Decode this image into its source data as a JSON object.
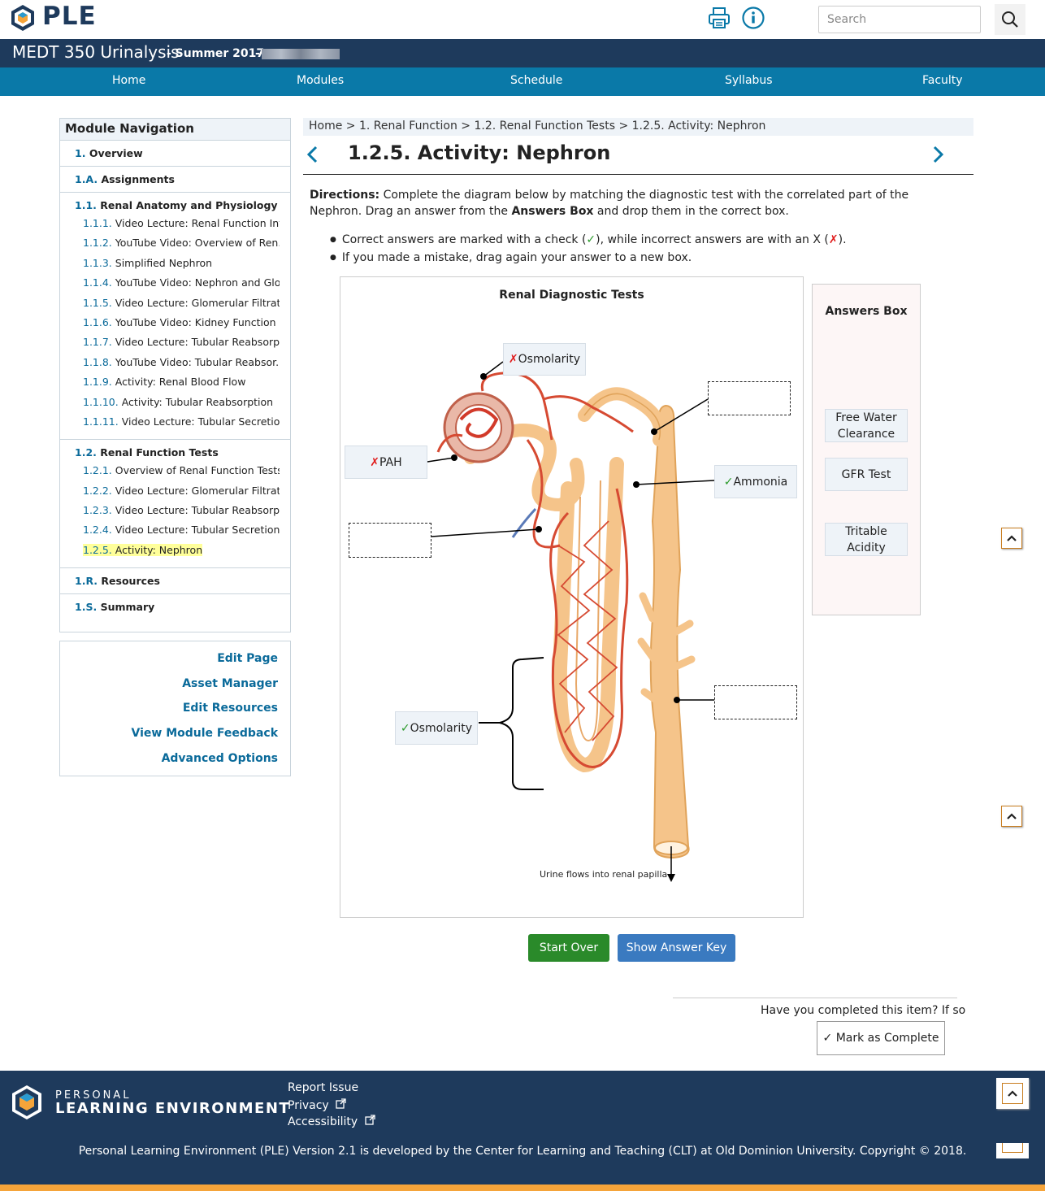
{
  "header": {
    "logo_text": "PLE",
    "search_placeholder": "Search",
    "course_title": "MEDT 350 Urinalysis",
    "course_term": "- Summer 2017",
    "course_sep": "-"
  },
  "nav": [
    "Home",
    "Modules",
    "Schedule",
    "Syllabus",
    "Faculty"
  ],
  "sidebar": {
    "title": "Module Navigation",
    "top_items": [
      {
        "num": "1.",
        "label": "Overview"
      },
      {
        "num": "1.A.",
        "label": "Assignments"
      }
    ],
    "group1": {
      "num": "1.1.",
      "label": "Renal Anatomy and Physiology",
      "items": [
        {
          "num": "1.1.1.",
          "label": "Video Lecture: Renal Function Int..."
        },
        {
          "num": "1.1.2.",
          "label": "YouTube Video: Overview of Ren..."
        },
        {
          "num": "1.1.3.",
          "label": "Simplified Nephron"
        },
        {
          "num": "1.1.4.",
          "label": "YouTube Video: Nephron and Glo..."
        },
        {
          "num": "1.1.5.",
          "label": "Video Lecture: Glomerular Filtrati..."
        },
        {
          "num": "1.1.6.",
          "label": "YouTube Video: Kidney Function"
        },
        {
          "num": "1.1.7.",
          "label": "Video Lecture: Tubular Reabsorpt..."
        },
        {
          "num": "1.1.8.",
          "label": "YouTube Video: Tubular Reabsor..."
        },
        {
          "num": "1.1.9.",
          "label": "Activity: Renal Blood Flow"
        },
        {
          "num": "1.1.10.",
          "label": "Activity: Tubular Reabsorption"
        },
        {
          "num": "1.1.11.",
          "label": "Video Lecture: Tubular Secretio..."
        }
      ]
    },
    "group2": {
      "num": "1.2.",
      "label": "Renal Function Tests",
      "items": [
        {
          "num": "1.2.1.",
          "label": "Overview of Renal Function Tests"
        },
        {
          "num": "1.2.2.",
          "label": "Video Lecture: Glomerular Filtrati..."
        },
        {
          "num": "1.2.3.",
          "label": "Video Lecture: Tubular Reabsorpt..."
        },
        {
          "num": "1.2.4.",
          "label": "Video Lecture: Tubular Secretion ..."
        },
        {
          "num": "1.2.5.",
          "label": "Activity: Nephron"
        }
      ]
    },
    "bottom_items": [
      {
        "num": "1.R.",
        "label": "Resources"
      },
      {
        "num": "1.S.",
        "label": "Summary"
      }
    ],
    "admin_links": [
      "Edit Page",
      "Asset Manager",
      "Edit Resources",
      "View Module Feedback",
      "Advanced Options"
    ]
  },
  "main": {
    "breadcrumb": "Home > 1. Renal Function > 1.2. Renal Function Tests > 1.2.5. Activity: Nephron",
    "title": "1.2.5. Activity: Nephron",
    "directions_label": "Directions:",
    "directions_1": " Complete the diagram below by matching the diagnostic test with the correlated part of the Nephron. Drag an answer from the ",
    "answers_box_bold": "Answers Box",
    "directions_2": " and drop them in the correct box.",
    "bullet1_a": "Correct answers are marked with a check (",
    "bullet1_b": "), while incorrect answers are with an X (",
    "bullet1_c": ").",
    "bullet2": "If you made a mistake, drag again your answer to a new box.",
    "check_mark": "✓",
    "cross_mark": "✗"
  },
  "activity": {
    "diagram_title": "Renal Diagnostic Tests",
    "placed": [
      {
        "label": "Osmolarity",
        "status": "✗"
      },
      {
        "label": "PAH",
        "status": "✗"
      },
      {
        "label": "Ammonia",
        "status": "✓"
      },
      {
        "label": "Osmolarity",
        "status": "✓"
      }
    ],
    "caption": "Urine flows into renal papilla",
    "answers_title": "Answers Box",
    "answers": [
      "Free Water Clearance",
      "GFR Test",
      "Tritable Acidity"
    ],
    "start_over": "Start Over",
    "show_key": "Show Answer Key",
    "colors": {
      "start_over": "#2a8a2a",
      "show_key": "#3a7ac0"
    }
  },
  "completion": {
    "question": "Have you completed this item? If so",
    "button": "✓ Mark as Complete"
  },
  "footer": {
    "brand_top": "PERSONAL",
    "brand_bottom": "LEARNING ENVIRONMENT",
    "links": [
      "Report Issue",
      "Privacy",
      "Accessibility"
    ],
    "copyright": "Personal Learning Environment (PLE) Version 2.1 is developed by the Center for Learning and Teaching (CLT) at Old Dominion University. Copyright © 2018."
  }
}
